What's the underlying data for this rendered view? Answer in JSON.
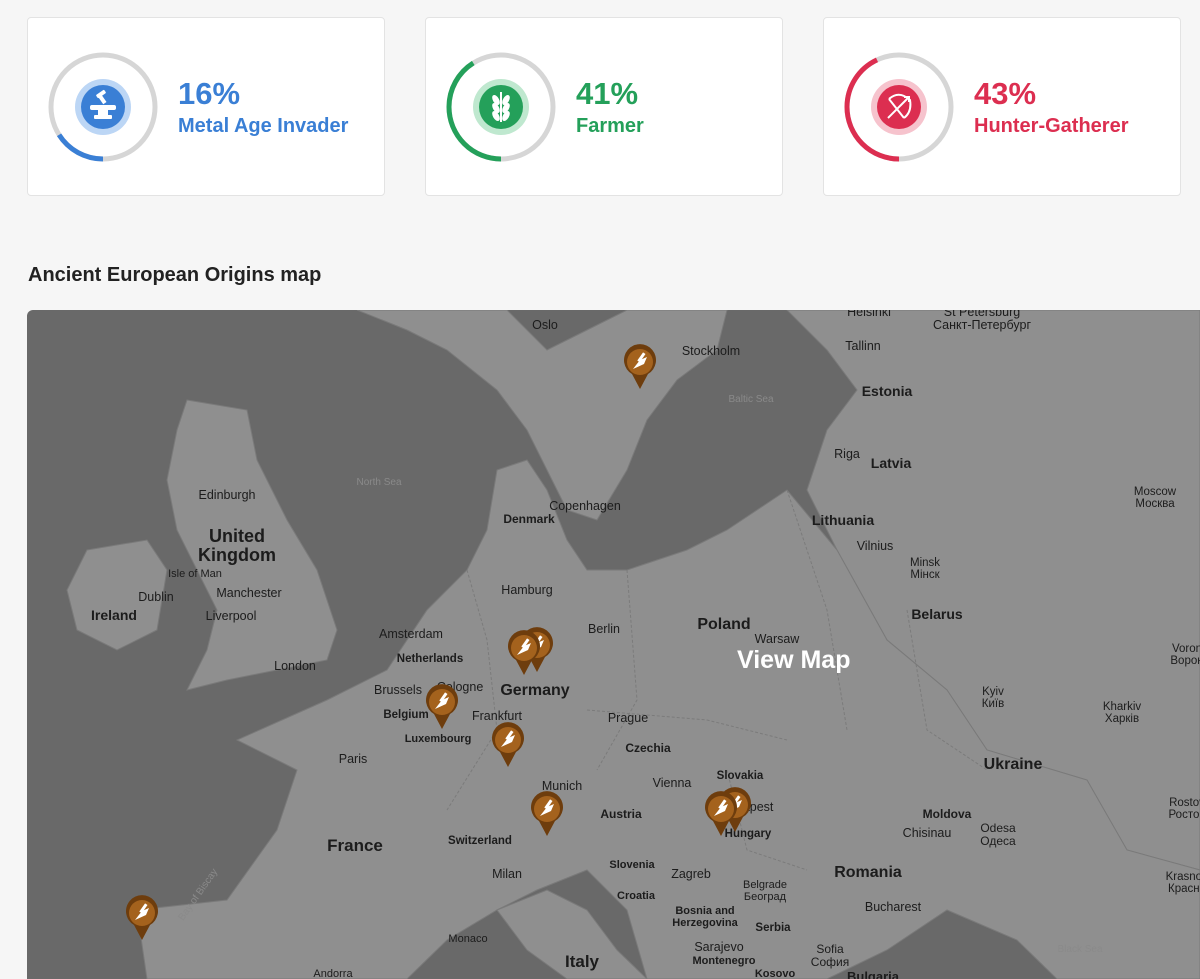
{
  "cards": [
    {
      "percent": "16%",
      "label": "Metal Age Invader",
      "color": "#3a7fd5",
      "fraction": 0.16,
      "icon": "anvil-icon"
    },
    {
      "percent": "41%",
      "label": "Farmer",
      "color": "#24a05a",
      "fraction": 0.41,
      "icon": "wheat-icon"
    },
    {
      "percent": "43%",
      "label": "Hunter-Gatherer",
      "color": "#dc2e50",
      "fraction": 0.43,
      "icon": "bow-arrow-icon"
    }
  ],
  "map_section": {
    "title": "Ancient European Origins map",
    "view_label": "View Map"
  },
  "map_labels": {
    "oslo": "Oslo",
    "helsinki": "Helsinki",
    "st_petersburg": "St Petersburg",
    "st_petersburg_ru": "Санкт-Петербург",
    "stockholm": "Stockholm",
    "tallinn": "Tallinn",
    "estonia": "Estonia",
    "baltic_sea": "Baltic Sea",
    "riga": "Riga",
    "latvia": "Latvia",
    "north_sea": "North Sea",
    "edinburgh": "Edinburgh",
    "copenhagen": "Copenhagen",
    "denmark": "Denmark",
    "moscow": "Moscow",
    "moscow_ru": "Москва",
    "lithuania": "Lithuania",
    "vilnius": "Vilnius",
    "united_kingdom_1": "United",
    "united_kingdom_2": "Kingdom",
    "isle_of_man": "Isle of Man",
    "dublin": "Dublin",
    "ireland": "Ireland",
    "manchester": "Manchester",
    "liverpool": "Liverpool",
    "minsk": "Minsk",
    "minsk_ru": "Мінск",
    "hamburg": "Hamburg",
    "amsterdam": "Amsterdam",
    "berlin": "Berlin",
    "belarus": "Belarus",
    "netherlands": "Netherlands",
    "poland": "Poland",
    "warsaw": "Warsaw",
    "london": "London",
    "voronezh": "Voron",
    "voronezh_ru": "Ворон",
    "brussels": "Brussels",
    "cologne": "Cologne",
    "germany": "Germany",
    "kyiv": "Kyiv",
    "kyiv_ua": "Київ",
    "belgium": "Belgium",
    "frankfurt": "Frankfurt",
    "kharkiv": "Kharkiv",
    "kharkiv_ua": "Харків",
    "luxembourg": "Luxembourg",
    "prague": "Prague",
    "paris": "Paris",
    "czechia": "Czechia",
    "ukraine": "Ukraine",
    "slovakia": "Slovakia",
    "vienna": "Vienna",
    "munich": "Munich",
    "budapest": "Budapest",
    "rostov": "Rostov",
    "rostov_ru": "Ростов",
    "austria": "Austria",
    "moldova": "Moldova",
    "hungary": "Hungary",
    "chisinau": "Chisinau",
    "odesa": "Odesa",
    "odesa_ua": "Одеса",
    "switzerland": "Switzerland",
    "france": "France",
    "slovenia": "Slovenia",
    "zagreb": "Zagreb",
    "romania": "Romania",
    "milan": "Milan",
    "krasnodar": "Krasnod",
    "krasnodar_ru": "Красно",
    "croatia": "Croatia",
    "belgrade": "Belgrade",
    "belgrade_sr": "Београд",
    "bay_of_biscay": "Bay of Biscay",
    "bucharest": "Bucharest",
    "bosnia_1": "Bosnia and",
    "bosnia_2": "Herzegovina",
    "serbia": "Serbia",
    "monaco": "Monaco",
    "black_sea": "Black Sea",
    "sarajevo": "Sarajevo",
    "sofia": "Sofia",
    "sofia_bg": "София",
    "montenegro": "Montenegro",
    "italy": "Italy",
    "andorra": "Andorra",
    "kosovo": "Kosovo",
    "bulgaria": "Bulgaria"
  }
}
